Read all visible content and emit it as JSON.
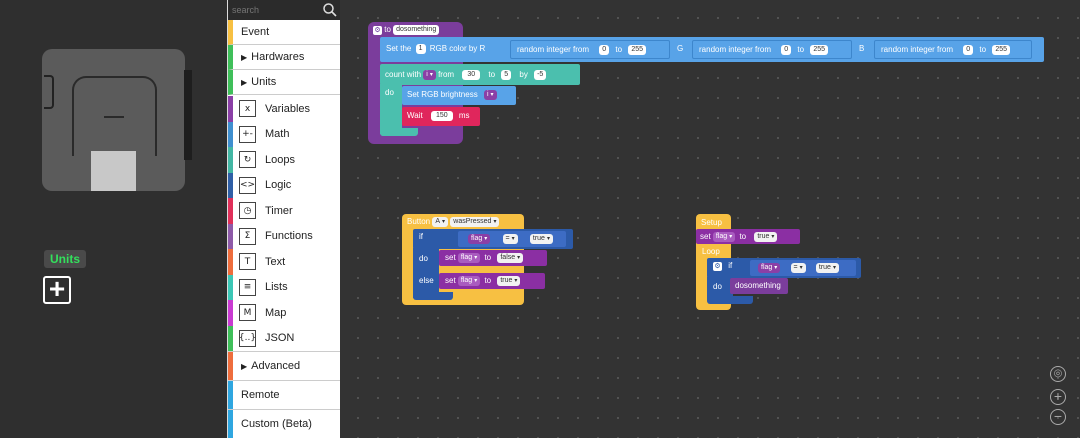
{
  "device": {
    "units_label": "Units",
    "add_label": "+"
  },
  "toolbox": {
    "search_placeholder": "search",
    "event": "Event",
    "hardwares": "Hardwares",
    "units": "Units",
    "items": [
      {
        "label": "Variables",
        "color": "#8b3fa6",
        "icon": "x"
      },
      {
        "label": "Math",
        "color": "#3f8fcf",
        "icon": "+-"
      },
      {
        "label": "Loops",
        "color": "#43b7a4",
        "icon": "↻"
      },
      {
        "label": "Logic",
        "color": "#2f5fa6",
        "icon": "<>"
      },
      {
        "label": "Timer",
        "color": "#e0305a",
        "icon": "◷"
      },
      {
        "label": "Functions",
        "color": "#8e5aa8",
        "icon": "Σ"
      },
      {
        "label": "Text",
        "color": "#ee6d3d",
        "icon": "T"
      },
      {
        "label": "Lists",
        "color": "#3cc7b6",
        "icon": "≡"
      },
      {
        "label": "Map",
        "color": "#c93bd1",
        "icon": "M"
      },
      {
        "label": "JSON",
        "color": "#3fbf5a",
        "icon": "{..}"
      }
    ],
    "advanced": "Advanced",
    "remote": "Remote",
    "custom": "Custom (Beta)",
    "colors": {
      "event": "#f7c042",
      "hardwares": "#3fbf5a",
      "units": "#3fbf5a",
      "advanced": "#ee6d3d",
      "remote": "#2fa6e0",
      "custom": "#2fa6e0"
    }
  },
  "workspace": {
    "func": {
      "to": "to",
      "name": "dosomething",
      "set_the": "Set the",
      "index": "1",
      "rgb_by_r": "RGB color by R",
      "rand": "random integer from",
      "r_from": "0",
      "to_kw": "to",
      "r_to": "255",
      "g": "G",
      "g_from": "0",
      "g_to": "255",
      "b": "B",
      "b_from": "0",
      "b_to": "255",
      "count_with": "count with",
      "var_i": "i",
      "from": "from",
      "c_from": "30",
      "c_to": "5",
      "by": "by",
      "c_by": "-5",
      "do": "do",
      "set_brightness": "Set RGB brightness",
      "wait": "Wait",
      "wait_val": "150",
      "ms": "ms"
    },
    "button": {
      "button": "Button",
      "btn_name": "A",
      "event": "wasPressed",
      "if": "if",
      "flag": "flag",
      "eq": "=",
      "true": "true",
      "do": "do",
      "set": "set",
      "to": "to",
      "false": "false",
      "else": "else"
    },
    "setup": {
      "setup": "Setup",
      "set": "set",
      "flag": "flag",
      "to": "to",
      "true": "true",
      "loop": "Loop",
      "if": "if",
      "eq": "=",
      "do": "do",
      "call": "dosomething"
    }
  }
}
